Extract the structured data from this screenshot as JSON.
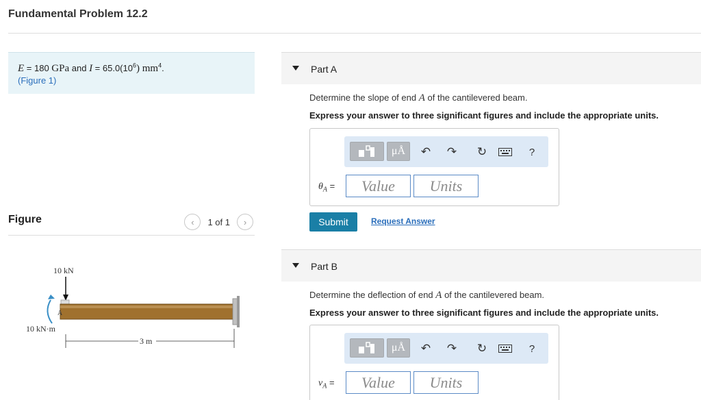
{
  "page": {
    "title": "Fundamental Problem 12.2"
  },
  "given": {
    "E_sym": "E",
    "E_val": " = 180 ",
    "E_unit": "GPa",
    "and": " and ",
    "I_sym": "I",
    "I_val": " = 65.0(10",
    "I_exp": "6",
    "I_unit": ") mm",
    "I_unit_exp": "4",
    "period": ".",
    "figure_link": "(Figure 1)"
  },
  "figure": {
    "label": "Figure",
    "pager_text": "1 of 1",
    "prev_icon": "chevron-left-icon",
    "next_icon": "chevron-right-icon",
    "load_label": "10 kN",
    "moment_label": "10 kN·m",
    "point_label": "A",
    "length_label": "3 m"
  },
  "parts": [
    {
      "title": "Part A",
      "question_pre": "Determine the slope of end ",
      "question_var": "A",
      "question_post": " of the cantilevered beam.",
      "express": "Express your answer to three significant figures and include the appropriate units.",
      "var_sym": "θ",
      "var_sub": "A",
      "var_eq": " =",
      "value_placeholder": "Value",
      "units_placeholder": "Units"
    },
    {
      "title": "Part B",
      "question_pre": "Determine the deflection of end ",
      "question_var": "A",
      "question_post": " of the cantilevered beam.",
      "express": "Express your answer to three significant figures and include the appropriate units.",
      "var_sym": "v",
      "var_sub": "A",
      "var_eq": " =",
      "value_placeholder": "Value",
      "units_placeholder": "Units"
    }
  ],
  "toolbar": {
    "units_btn": "μÅ",
    "help": "?",
    "icons": [
      "templates-icon",
      "units-icon",
      "undo-icon",
      "redo-icon",
      "reset-icon",
      "keyboard-icon",
      "help-icon"
    ]
  },
  "actions": {
    "submit": "Submit",
    "request_answer": "Request Answer"
  },
  "colors": {
    "accent": "#1a7fa6",
    "link": "#2a6ebb",
    "given_bg": "#e8f4f8",
    "toolbar_bg": "#dde9f6",
    "beam": "#a0712e"
  }
}
